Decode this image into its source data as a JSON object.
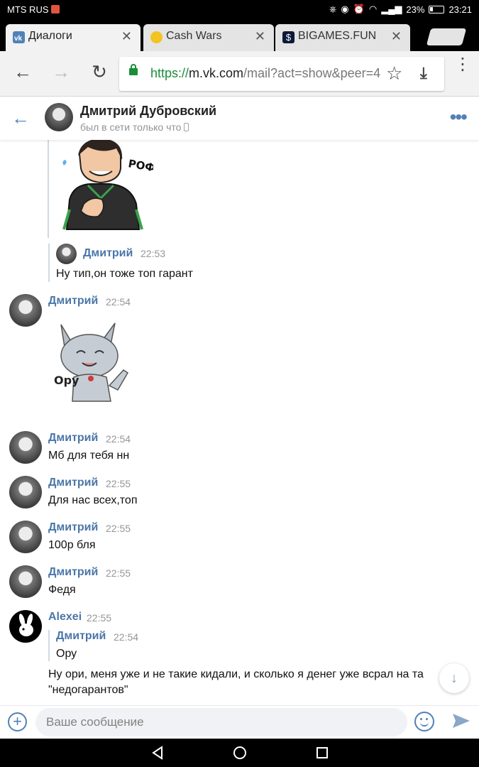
{
  "status_bar": {
    "carrier": "MTS RUS",
    "battery": "23%",
    "time": "23:21"
  },
  "tabs": [
    {
      "title": "Диалоги",
      "favicon": "vk-icon",
      "active": true
    },
    {
      "title": "Cash Wars",
      "favicon": "coin-icon",
      "active": false
    },
    {
      "title": "BIGAMES.FUN - $",
      "favicon": "dollar-icon",
      "active": false
    }
  ],
  "address_bar": {
    "scheme": "https://",
    "host": "m.vk.com",
    "path": "/mail?act=show&peer=4"
  },
  "conversation": {
    "name": "Дмитрий Дубровский",
    "status": "был в сети только что"
  },
  "messages": {
    "fwd_top": {
      "sender": "Дмитрий",
      "time": "22:53",
      "text": "Ну тип,он тоже топ гарант"
    },
    "m1": {
      "sender": "Дмитрий",
      "time": "22:54",
      "sticker_caption": "Ору"
    },
    "sticker_top_caption": "РОФЛ!",
    "m2": {
      "sender": "Дмитрий",
      "time": "22:54",
      "text": "Мб для тебя нн"
    },
    "m3": {
      "sender": "Дмитрий",
      "time": "22:55",
      "text": "Для нас всех,топ"
    },
    "m4": {
      "sender": "Дмитрий",
      "time": "22:55",
      "text": "100р бля"
    },
    "m5": {
      "sender": "Дмитрий",
      "time": "22:55",
      "text": "Федя"
    },
    "m6": {
      "sender": "Alexei",
      "time": "22:55",
      "fwd": {
        "sender": "Дмитрий",
        "time": "22:54",
        "text": "Ору"
      },
      "text_line1": "Ну ори, меня уже и не такие кидали, и сколько я денег уже всрал на та",
      "text_line2": "\"недогарантов\""
    }
  },
  "composer": {
    "placeholder": "Ваше сообщение"
  },
  "colors": {
    "vk_blue": "#5181b8",
    "sender_blue": "#4a76a8",
    "secure_green": "#1a8d3a"
  }
}
